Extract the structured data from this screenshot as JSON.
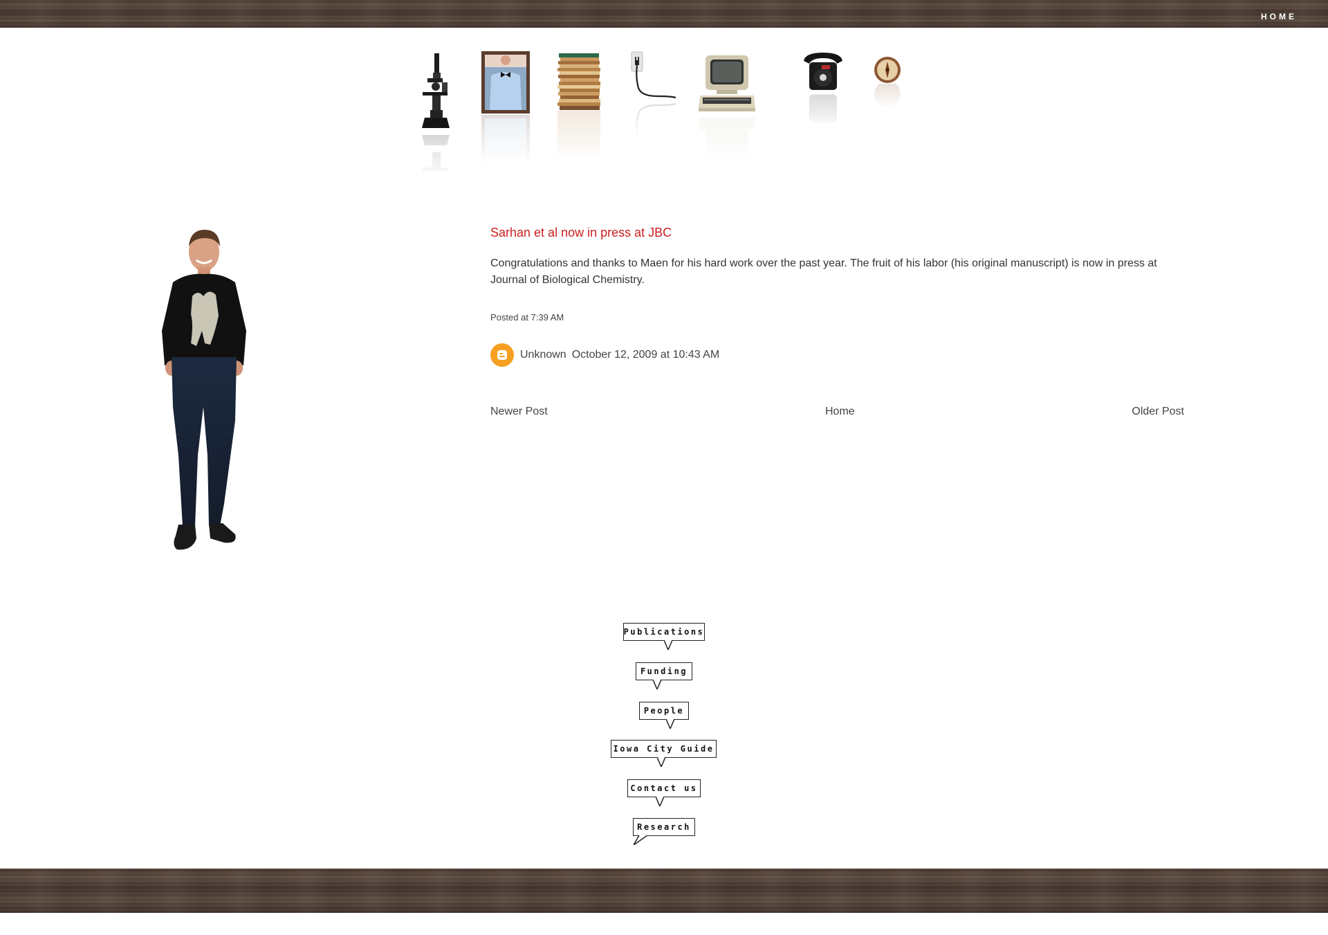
{
  "header": {
    "home_label": "HOME"
  },
  "shelf": {
    "icons": [
      "microscope-icon",
      "portrait-frame-icon",
      "paper-stack-icon",
      "wall-outlet-icon",
      "vintage-computer-icon",
      "rotary-telephone-icon",
      "compass-icon"
    ]
  },
  "post": {
    "title": "Sarhan et al now in press at JBC",
    "body": "Congratulations and thanks to Maen for his hard work over the past year. The fruit of his labor (his original manuscript) is now in press at Journal of Biological Chemistry.",
    "footer": "Posted at 7:39 AM",
    "comment": {
      "author": "Unknown",
      "timestamp": "October 12, 2009 at 10:43 AM"
    }
  },
  "pager": {
    "newer": "Newer Post",
    "home": "Home",
    "older": "Older Post"
  },
  "nav_bubbles": [
    "Publications",
    "Funding",
    "People",
    "Iowa City Guide",
    "Contact us",
    "Research"
  ],
  "colors": {
    "title_red": "#cc1f1f",
    "blogger_orange": "#f6a021",
    "wood_brown": "#4a3a31"
  }
}
